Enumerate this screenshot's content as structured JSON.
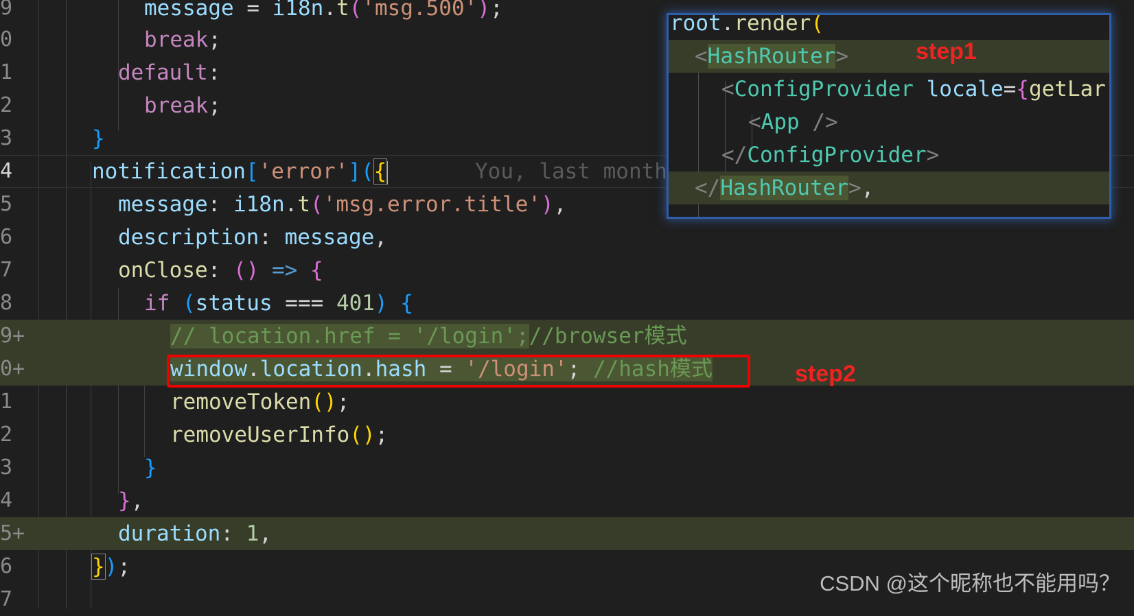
{
  "editor": {
    "line_numbers": [
      "9",
      "0",
      "1",
      "2",
      "3",
      "4",
      "5",
      "6",
      "7",
      "8",
      "9+",
      "0+",
      "1",
      "2",
      "3",
      "4",
      "5+",
      "6",
      "7"
    ],
    "blame_text": "You, last month",
    "lines": {
      "l0": {
        "prop": "message",
        "eq": " = ",
        "obj": "i18n",
        "dot": ".",
        "fn": "t",
        "open": "(",
        "str": "'msg.500'",
        "close": ")",
        "semi": ";"
      },
      "l1": {
        "kw": "break",
        "semi": ";"
      },
      "l2": {
        "kw": "default",
        "colon": ":"
      },
      "l3": {
        "kw": "break",
        "semi": ";"
      },
      "l4": {
        "brace": "}"
      },
      "l5": {
        "obj": "notification",
        "open_sq": "[",
        "str": "'error'",
        "close_sq": "]",
        "open_paren": "(",
        "open_brace": "{"
      },
      "l6": {
        "prop": "message",
        "colon": ": ",
        "obj": "i18n",
        "dot": ".",
        "fn": "t",
        "open": "(",
        "str": "'msg.error.title'",
        "close": ")",
        "comma": ","
      },
      "l7": {
        "prop": "description",
        "colon": ": ",
        "val": "message",
        "comma": ","
      },
      "l8": {
        "fn": "onClose",
        "colon": ": ",
        "parens": "()",
        "arrow": " => ",
        "brace": "{"
      },
      "l9": {
        "kw": "if",
        "open": " (",
        "var": "status",
        "op": " === ",
        "num": "401",
        "close": ")",
        "brace": " {"
      },
      "l10": {
        "comment1": "// location.href = '/login';",
        "comment2": "//browser模式"
      },
      "l11": {
        "obj": "window",
        "dot1": ".",
        "prop1": "location",
        "dot2": ".",
        "prop2": "hash",
        "eq": " = ",
        "str": "'/login'",
        "semi": "; ",
        "comment": "//hash模式"
      },
      "l12": {
        "fn": "removeToken",
        "parens": "()",
        "semi": ";"
      },
      "l13": {
        "fn": "removeUserInfo",
        "parens": "()",
        "semi": ";"
      },
      "l14": {
        "brace": "}"
      },
      "l15": {
        "brace": "}",
        "comma": ","
      },
      "l16": {
        "prop": "duration",
        "colon": ": ",
        "num": "1",
        "comma": ","
      },
      "l17": {
        "brace": "}",
        "paren": ")",
        "semi": ";"
      }
    }
  },
  "popup": {
    "l0": {
      "obj": "root",
      "dot": ".",
      "fn": "render",
      "open": "("
    },
    "l1": {
      "lt": "<",
      "tag": "HashRouter",
      "gt": ">"
    },
    "l2": {
      "lt": "<",
      "tag": "ConfigProvider",
      "attr": " locale",
      "eq": "=",
      "brace": "{",
      "fn": "getLar"
    },
    "l3": {
      "lt": "<",
      "tag": "App",
      "end": " />"
    },
    "l4": {
      "lt": "</",
      "tag": "ConfigProvider",
      "gt": ">"
    },
    "l5": {
      "lt": "</",
      "tag": "HashRouter",
      "gt": ">",
      "comma": ","
    }
  },
  "annotations": {
    "step1": "step1",
    "step2": "step2"
  },
  "watermark": "CSDN @这个昵称也不能用吗？",
  "colors": {
    "background": "#1f1f1f",
    "added_line": "#373d29",
    "highlight_box": "#f00000",
    "annotation_text": "#f22222",
    "popup_border": "#2f5ea8"
  }
}
